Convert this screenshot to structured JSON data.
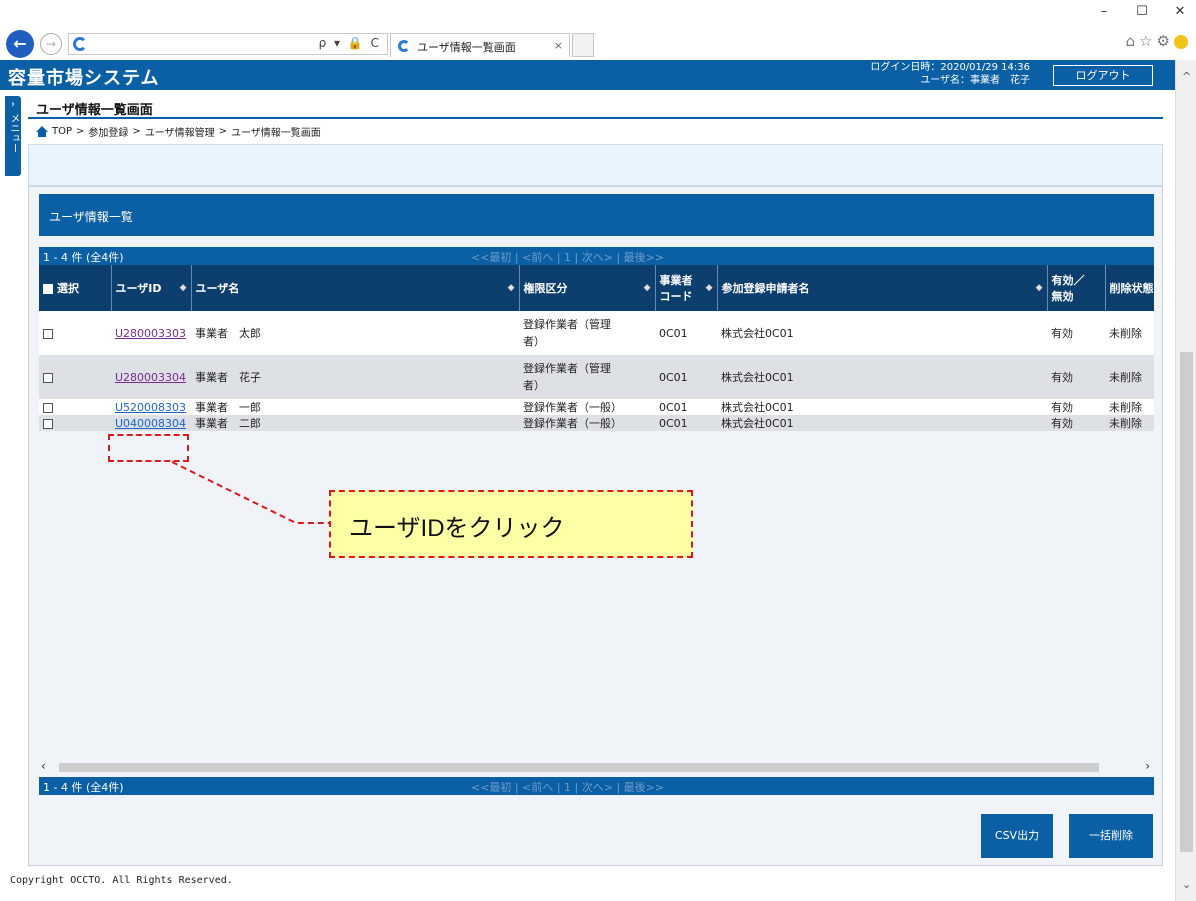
{
  "browser": {
    "tab_title": "ユーザ情報一覧画面",
    "tab_close": "×",
    "address_tools": "ρ ▾ 🔒 C",
    "window_controls": {
      "minimize": "–",
      "maximize": "☐",
      "close": "✕"
    },
    "toolbar_icons": [
      "home-icon",
      "star-icon",
      "gear-icon",
      "smiley-icon"
    ]
  },
  "app": {
    "title": "容量市場システム",
    "login_time": "ログイン日時：2020/01/29 14:36",
    "user_name": "ユーザ名：事業者　花子",
    "logout_label": "ログアウト",
    "side_menu_label": "メニュー",
    "header_color": "#0b5fa4"
  },
  "page": {
    "title": "ユーザ情報一覧画面",
    "breadcrumb": [
      "TOP",
      "参加登録",
      "ユーザ情報管理",
      "ユーザ情報一覧画面"
    ],
    "breadcrumb_sep": ">"
  },
  "list": {
    "panel_title": "ユーザ情報一覧",
    "count_text": "1 - 4 件 (全4件)",
    "pager_nav": "<<最初 | <前へ | 1 | 次へ> | 最後>>",
    "columns": [
      "選択",
      "ユーザID",
      "ユーザ名",
      "権限区分",
      "事業者コード",
      "参加登録申請者名",
      "有効／無効",
      "削除状態"
    ],
    "col_labels": {
      "select": "選択",
      "user_id": "ユーザID",
      "user_name": "ユーザ名",
      "role": "権限区分",
      "biz_code_1": "事業者",
      "biz_code_2": "コード",
      "applicant": "参加登録申請者名",
      "valid_1": "有効／",
      "valid_2": "無効",
      "deleted": "削除状態"
    },
    "rows": [
      {
        "user_id": "U280003303",
        "user_name": "事業者　太郎",
        "role_1": "登録作業者（管理",
        "role_2": "者）",
        "biz_code": "0C01",
        "applicant": "株式会社0C01",
        "valid": "有効",
        "deleted": "未削除"
      },
      {
        "user_id": "U280003304",
        "user_name": "事業者　花子",
        "role_1": "登録作業者（管理",
        "role_2": "者）",
        "biz_code": "0C01",
        "applicant": "株式会社0C01",
        "valid": "有効",
        "deleted": "未削除"
      },
      {
        "user_id": "U520008303",
        "user_name": "事業者　一郎",
        "role_1": "登録作業者（一般）",
        "role_2": "",
        "biz_code": "0C01",
        "applicant": "株式会社0C01",
        "valid": "有効",
        "deleted": "未削除"
      },
      {
        "user_id": "U040008304",
        "user_name": "事業者　二郎",
        "role_1": "登録作業者（一般）",
        "role_2": "",
        "biz_code": "0C01",
        "applicant": "株式会社0C01",
        "valid": "有効",
        "deleted": "未削除"
      }
    ],
    "csv_button": "CSV出力",
    "bulk_delete_button": "一括削除"
  },
  "annotation": {
    "callout_text": "ユーザIDをクリック",
    "highlight_color": "#e0181b",
    "callout_bg": "#ffffa6"
  },
  "footer": {
    "copyright": "Copyright OCCTO. All Rights Reserved."
  }
}
